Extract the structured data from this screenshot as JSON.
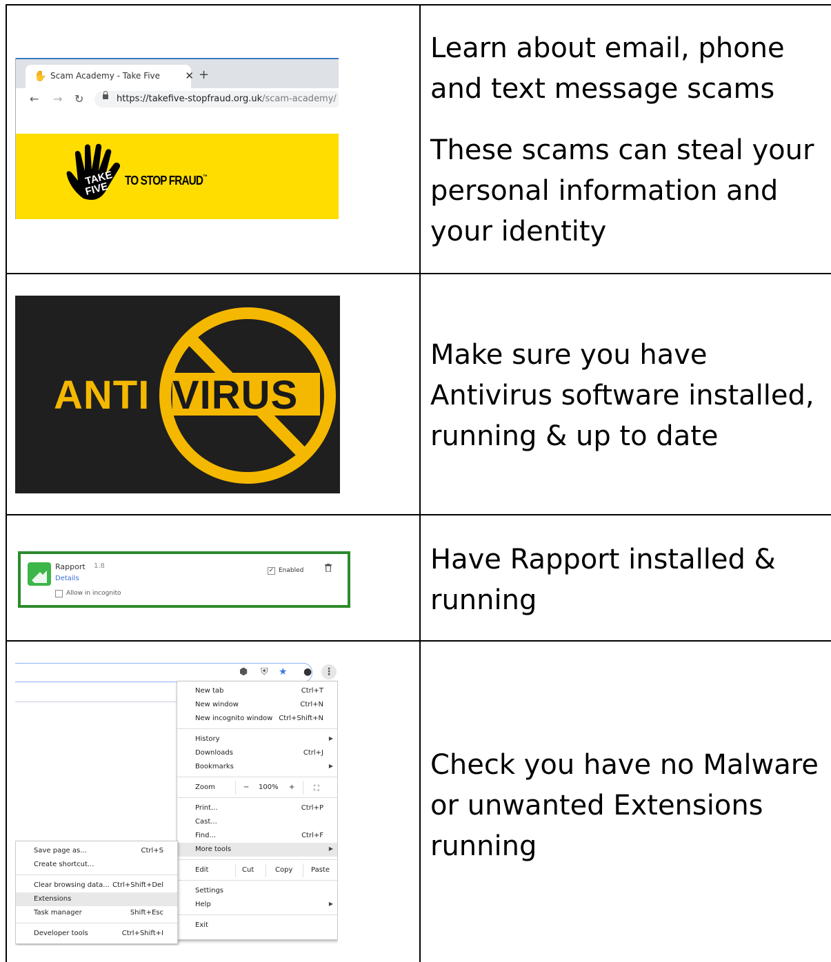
{
  "rows": [
    {
      "text": [
        "Learn about email, phone and text message scams",
        "These scams can steal your personal information and your identity"
      ]
    },
    {
      "text": [
        "Make sure you have Antivirus software installed, running & up to date"
      ]
    },
    {
      "text": [
        "Have Rapport installed & running"
      ]
    },
    {
      "text": [
        "Check you have no Malware or unwanted Extensions running"
      ]
    }
  ],
  "browser": {
    "tab_title": "Scam Academy - Take Five",
    "url_host": "https://takefive-stopfraud.org.uk",
    "url_path": "/scam-academy/",
    "logo_text": "TO STOP FRAUD",
    "logo_tm": "™",
    "hand_line1": "TAKE",
    "hand_line2": "FIVE"
  },
  "antivirus": {
    "anti": "ANTI",
    "virus": "VIRUS",
    "colors": {
      "background": "#1f1f1f",
      "yellow": "#f5b800"
    }
  },
  "rapport": {
    "name": "Rapport",
    "version": "1.8",
    "details": "Details",
    "incognito": "Allow in incognito",
    "enabled": "Enabled"
  },
  "chrome_menu": {
    "items": [
      {
        "label": "New tab",
        "shortcut": "Ctrl+T"
      },
      {
        "label": "New window",
        "shortcut": "Ctrl+N"
      },
      {
        "label": "New incognito window",
        "shortcut": "Ctrl+Shift+N"
      },
      {
        "label": "History",
        "shortcut": ""
      },
      {
        "label": "Downloads",
        "shortcut": "Ctrl+J"
      },
      {
        "label": "Bookmarks",
        "shortcut": ""
      },
      {
        "label": "Zoom",
        "shortcut": ""
      },
      {
        "label": "Print...",
        "shortcut": "Ctrl+P"
      },
      {
        "label": "Cast...",
        "shortcut": ""
      },
      {
        "label": "Find...",
        "shortcut": "Ctrl+F"
      },
      {
        "label": "More tools",
        "shortcut": ""
      },
      {
        "label": "Edit",
        "shortcut": ""
      },
      {
        "label": "Settings",
        "shortcut": ""
      },
      {
        "label": "Help",
        "shortcut": ""
      },
      {
        "label": "Exit",
        "shortcut": ""
      }
    ],
    "zoom": {
      "minus": "−",
      "value": "100%",
      "plus": "+"
    },
    "edit": {
      "cut": "Cut",
      "copy": "Copy",
      "paste": "Paste"
    },
    "submenu": [
      {
        "label": "Save page as...",
        "shortcut": "Ctrl+S"
      },
      {
        "label": "Create shortcut...",
        "shortcut": ""
      },
      {
        "label": "Clear browsing data...",
        "shortcut": "Ctrl+Shift+Del"
      },
      {
        "label": "Extensions",
        "shortcut": ""
      },
      {
        "label": "Task manager",
        "shortcut": "Shift+Esc"
      },
      {
        "label": "Developer tools",
        "shortcut": "Ctrl+Shift+I"
      }
    ]
  }
}
